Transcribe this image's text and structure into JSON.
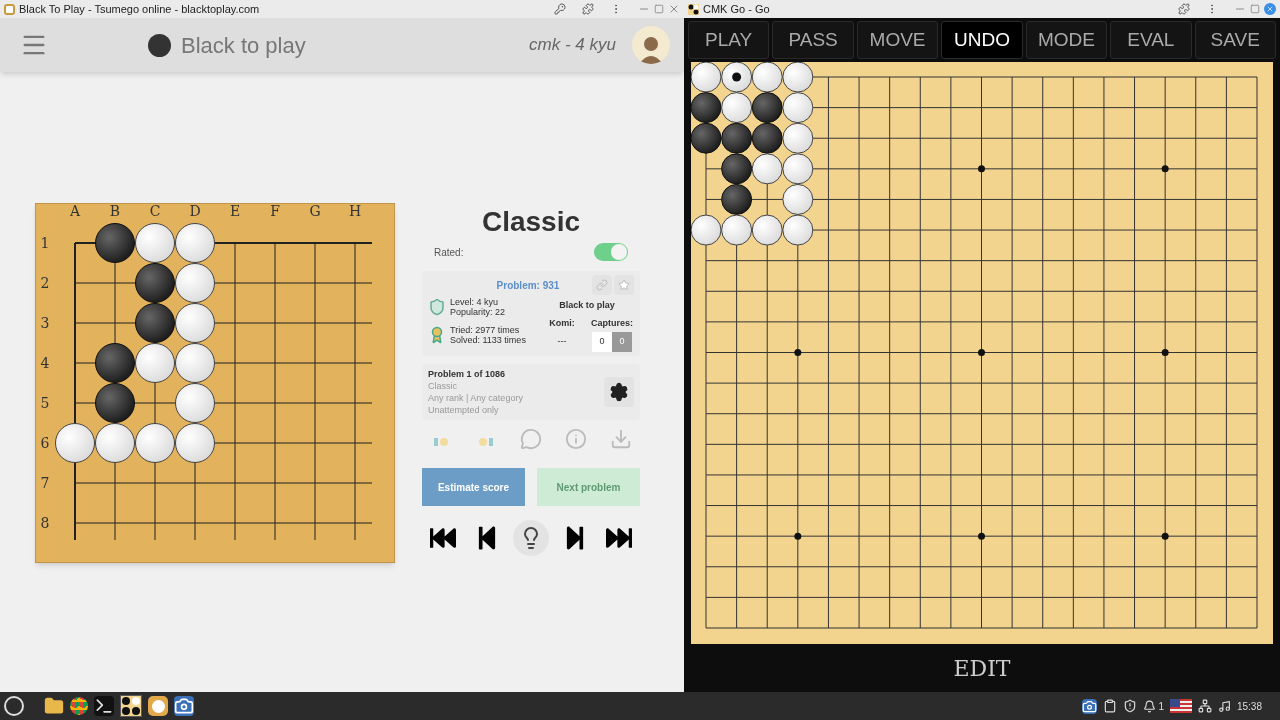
{
  "left_window": {
    "title": "Black To Play - Tsumego online - blacktoplay.com",
    "header": {
      "to_play": "Black to play",
      "user": "cmk - 4 kyu"
    },
    "board": {
      "columns": [
        "A",
        "B",
        "C",
        "D",
        "E",
        "F",
        "G",
        "H"
      ],
      "row_labels": [
        "1",
        "2",
        "3",
        "4",
        "5",
        "6",
        "7",
        "8"
      ],
      "rows": [
        [
          {
            "kind": "empty"
          },
          {
            "kind": "black"
          },
          {
            "kind": "white"
          },
          {
            "kind": "white"
          }
        ],
        [
          {
            "kind": "empty"
          },
          {
            "kind": "empty"
          },
          {
            "kind": "black"
          },
          {
            "kind": "white"
          }
        ],
        [
          {
            "kind": "empty"
          },
          {
            "kind": "empty"
          },
          {
            "kind": "black"
          },
          {
            "kind": "white"
          }
        ],
        [
          {
            "kind": "empty"
          },
          {
            "kind": "black"
          },
          {
            "kind": "white"
          },
          {
            "kind": "white"
          }
        ],
        [
          {
            "kind": "empty"
          },
          {
            "kind": "black"
          },
          {
            "kind": "empty"
          },
          {
            "kind": "white"
          }
        ],
        [
          {
            "kind": "white"
          },
          {
            "kind": "white"
          },
          {
            "kind": "white"
          },
          {
            "kind": "white"
          }
        ]
      ]
    },
    "panel": {
      "title": "Classic",
      "rated_label": "Rated:",
      "rated_on": true,
      "problem": "Problem: 931",
      "level": "Level: 4 kyu",
      "popularity": "Popularity: 22",
      "tried": "Tried: 2977 times",
      "solved": "Solved: 1133 times",
      "to_play": "Black to play",
      "komi_label": "Komi:",
      "komi": "---",
      "captures_label": "Captures:",
      "captures": [
        "0",
        "0"
      ],
      "set": {
        "title": "Problem 1 of 1086",
        "lines": [
          "Classic",
          "Any rank | Any category",
          "Unattempted only"
        ]
      },
      "buttons": [
        {
          "label": "Estimate score",
          "disabled": false
        },
        {
          "label": "Next problem",
          "disabled": true
        }
      ]
    }
  },
  "right_window": {
    "title": "CMK Go - Go",
    "toolbar": [
      {
        "label": "PLAY",
        "selected": false
      },
      {
        "label": "PASS",
        "selected": false
      },
      {
        "label": "MOVE",
        "selected": false
      },
      {
        "label": "UNDO",
        "selected": true
      },
      {
        "label": "MODE",
        "selected": false
      },
      {
        "label": "EVAL",
        "selected": false
      },
      {
        "label": "SAVE",
        "selected": false
      }
    ],
    "board": {
      "rows": [
        [
          {
            "kind": "white"
          },
          {
            "kind": "marked_white"
          },
          {
            "kind": "white"
          },
          {
            "kind": "white"
          }
        ],
        [
          {
            "kind": "black"
          },
          {
            "kind": "white"
          },
          {
            "kind": "black"
          },
          {
            "kind": "white"
          }
        ],
        [
          {
            "kind": "black"
          },
          {
            "kind": "black"
          },
          {
            "kind": "black"
          },
          {
            "kind": "white"
          }
        ],
        [
          {
            "kind": "empty"
          },
          {
            "kind": "black"
          },
          {
            "kind": "white"
          },
          {
            "kind": "white"
          }
        ],
        [
          {
            "kind": "empty"
          },
          {
            "kind": "black"
          },
          {
            "kind": "empty"
          },
          {
            "kind": "white"
          }
        ],
        [
          {
            "kind": "white"
          },
          {
            "kind": "white"
          },
          {
            "kind": "white"
          },
          {
            "kind": "white"
          }
        ]
      ]
    },
    "footer": "EDIT"
  },
  "taskbar": {
    "notification_count": "1",
    "clock": "15:38"
  }
}
